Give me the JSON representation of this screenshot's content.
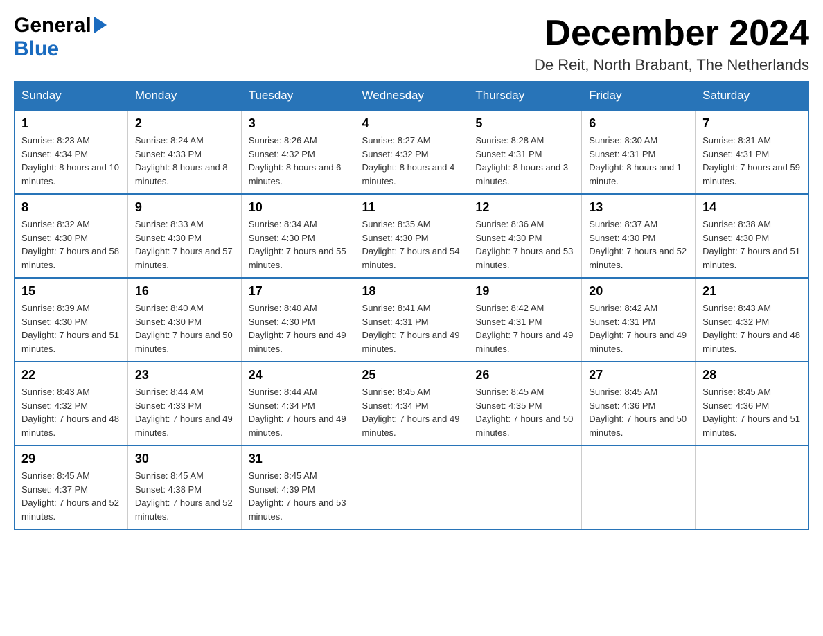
{
  "logo": {
    "general": "General",
    "blue": "Blue"
  },
  "title": "December 2024",
  "location": "De Reit, North Brabant, The Netherlands",
  "days_of_week": [
    "Sunday",
    "Monday",
    "Tuesday",
    "Wednesday",
    "Thursday",
    "Friday",
    "Saturday"
  ],
  "weeks": [
    [
      {
        "day": "1",
        "sunrise": "8:23 AM",
        "sunset": "4:34 PM",
        "daylight": "8 hours and 10 minutes."
      },
      {
        "day": "2",
        "sunrise": "8:24 AM",
        "sunset": "4:33 PM",
        "daylight": "8 hours and 8 minutes."
      },
      {
        "day": "3",
        "sunrise": "8:26 AM",
        "sunset": "4:32 PM",
        "daylight": "8 hours and 6 minutes."
      },
      {
        "day": "4",
        "sunrise": "8:27 AM",
        "sunset": "4:32 PM",
        "daylight": "8 hours and 4 minutes."
      },
      {
        "day": "5",
        "sunrise": "8:28 AM",
        "sunset": "4:31 PM",
        "daylight": "8 hours and 3 minutes."
      },
      {
        "day": "6",
        "sunrise": "8:30 AM",
        "sunset": "4:31 PM",
        "daylight": "8 hours and 1 minute."
      },
      {
        "day": "7",
        "sunrise": "8:31 AM",
        "sunset": "4:31 PM",
        "daylight": "7 hours and 59 minutes."
      }
    ],
    [
      {
        "day": "8",
        "sunrise": "8:32 AM",
        "sunset": "4:30 PM",
        "daylight": "7 hours and 58 minutes."
      },
      {
        "day": "9",
        "sunrise": "8:33 AM",
        "sunset": "4:30 PM",
        "daylight": "7 hours and 57 minutes."
      },
      {
        "day": "10",
        "sunrise": "8:34 AM",
        "sunset": "4:30 PM",
        "daylight": "7 hours and 55 minutes."
      },
      {
        "day": "11",
        "sunrise": "8:35 AM",
        "sunset": "4:30 PM",
        "daylight": "7 hours and 54 minutes."
      },
      {
        "day": "12",
        "sunrise": "8:36 AM",
        "sunset": "4:30 PM",
        "daylight": "7 hours and 53 minutes."
      },
      {
        "day": "13",
        "sunrise": "8:37 AM",
        "sunset": "4:30 PM",
        "daylight": "7 hours and 52 minutes."
      },
      {
        "day": "14",
        "sunrise": "8:38 AM",
        "sunset": "4:30 PM",
        "daylight": "7 hours and 51 minutes."
      }
    ],
    [
      {
        "day": "15",
        "sunrise": "8:39 AM",
        "sunset": "4:30 PM",
        "daylight": "7 hours and 51 minutes."
      },
      {
        "day": "16",
        "sunrise": "8:40 AM",
        "sunset": "4:30 PM",
        "daylight": "7 hours and 50 minutes."
      },
      {
        "day": "17",
        "sunrise": "8:40 AM",
        "sunset": "4:30 PM",
        "daylight": "7 hours and 49 minutes."
      },
      {
        "day": "18",
        "sunrise": "8:41 AM",
        "sunset": "4:31 PM",
        "daylight": "7 hours and 49 minutes."
      },
      {
        "day": "19",
        "sunrise": "8:42 AM",
        "sunset": "4:31 PM",
        "daylight": "7 hours and 49 minutes."
      },
      {
        "day": "20",
        "sunrise": "8:42 AM",
        "sunset": "4:31 PM",
        "daylight": "7 hours and 49 minutes."
      },
      {
        "day": "21",
        "sunrise": "8:43 AM",
        "sunset": "4:32 PM",
        "daylight": "7 hours and 48 minutes."
      }
    ],
    [
      {
        "day": "22",
        "sunrise": "8:43 AM",
        "sunset": "4:32 PM",
        "daylight": "7 hours and 48 minutes."
      },
      {
        "day": "23",
        "sunrise": "8:44 AM",
        "sunset": "4:33 PM",
        "daylight": "7 hours and 49 minutes."
      },
      {
        "day": "24",
        "sunrise": "8:44 AM",
        "sunset": "4:34 PM",
        "daylight": "7 hours and 49 minutes."
      },
      {
        "day": "25",
        "sunrise": "8:45 AM",
        "sunset": "4:34 PM",
        "daylight": "7 hours and 49 minutes."
      },
      {
        "day": "26",
        "sunrise": "8:45 AM",
        "sunset": "4:35 PM",
        "daylight": "7 hours and 50 minutes."
      },
      {
        "day": "27",
        "sunrise": "8:45 AM",
        "sunset": "4:36 PM",
        "daylight": "7 hours and 50 minutes."
      },
      {
        "day": "28",
        "sunrise": "8:45 AM",
        "sunset": "4:36 PM",
        "daylight": "7 hours and 51 minutes."
      }
    ],
    [
      {
        "day": "29",
        "sunrise": "8:45 AM",
        "sunset": "4:37 PM",
        "daylight": "7 hours and 52 minutes."
      },
      {
        "day": "30",
        "sunrise": "8:45 AM",
        "sunset": "4:38 PM",
        "daylight": "7 hours and 52 minutes."
      },
      {
        "day": "31",
        "sunrise": "8:45 AM",
        "sunset": "4:39 PM",
        "daylight": "7 hours and 53 minutes."
      },
      null,
      null,
      null,
      null
    ]
  ],
  "labels": {
    "sunrise": "Sunrise:",
    "sunset": "Sunset:",
    "daylight": "Daylight:"
  }
}
